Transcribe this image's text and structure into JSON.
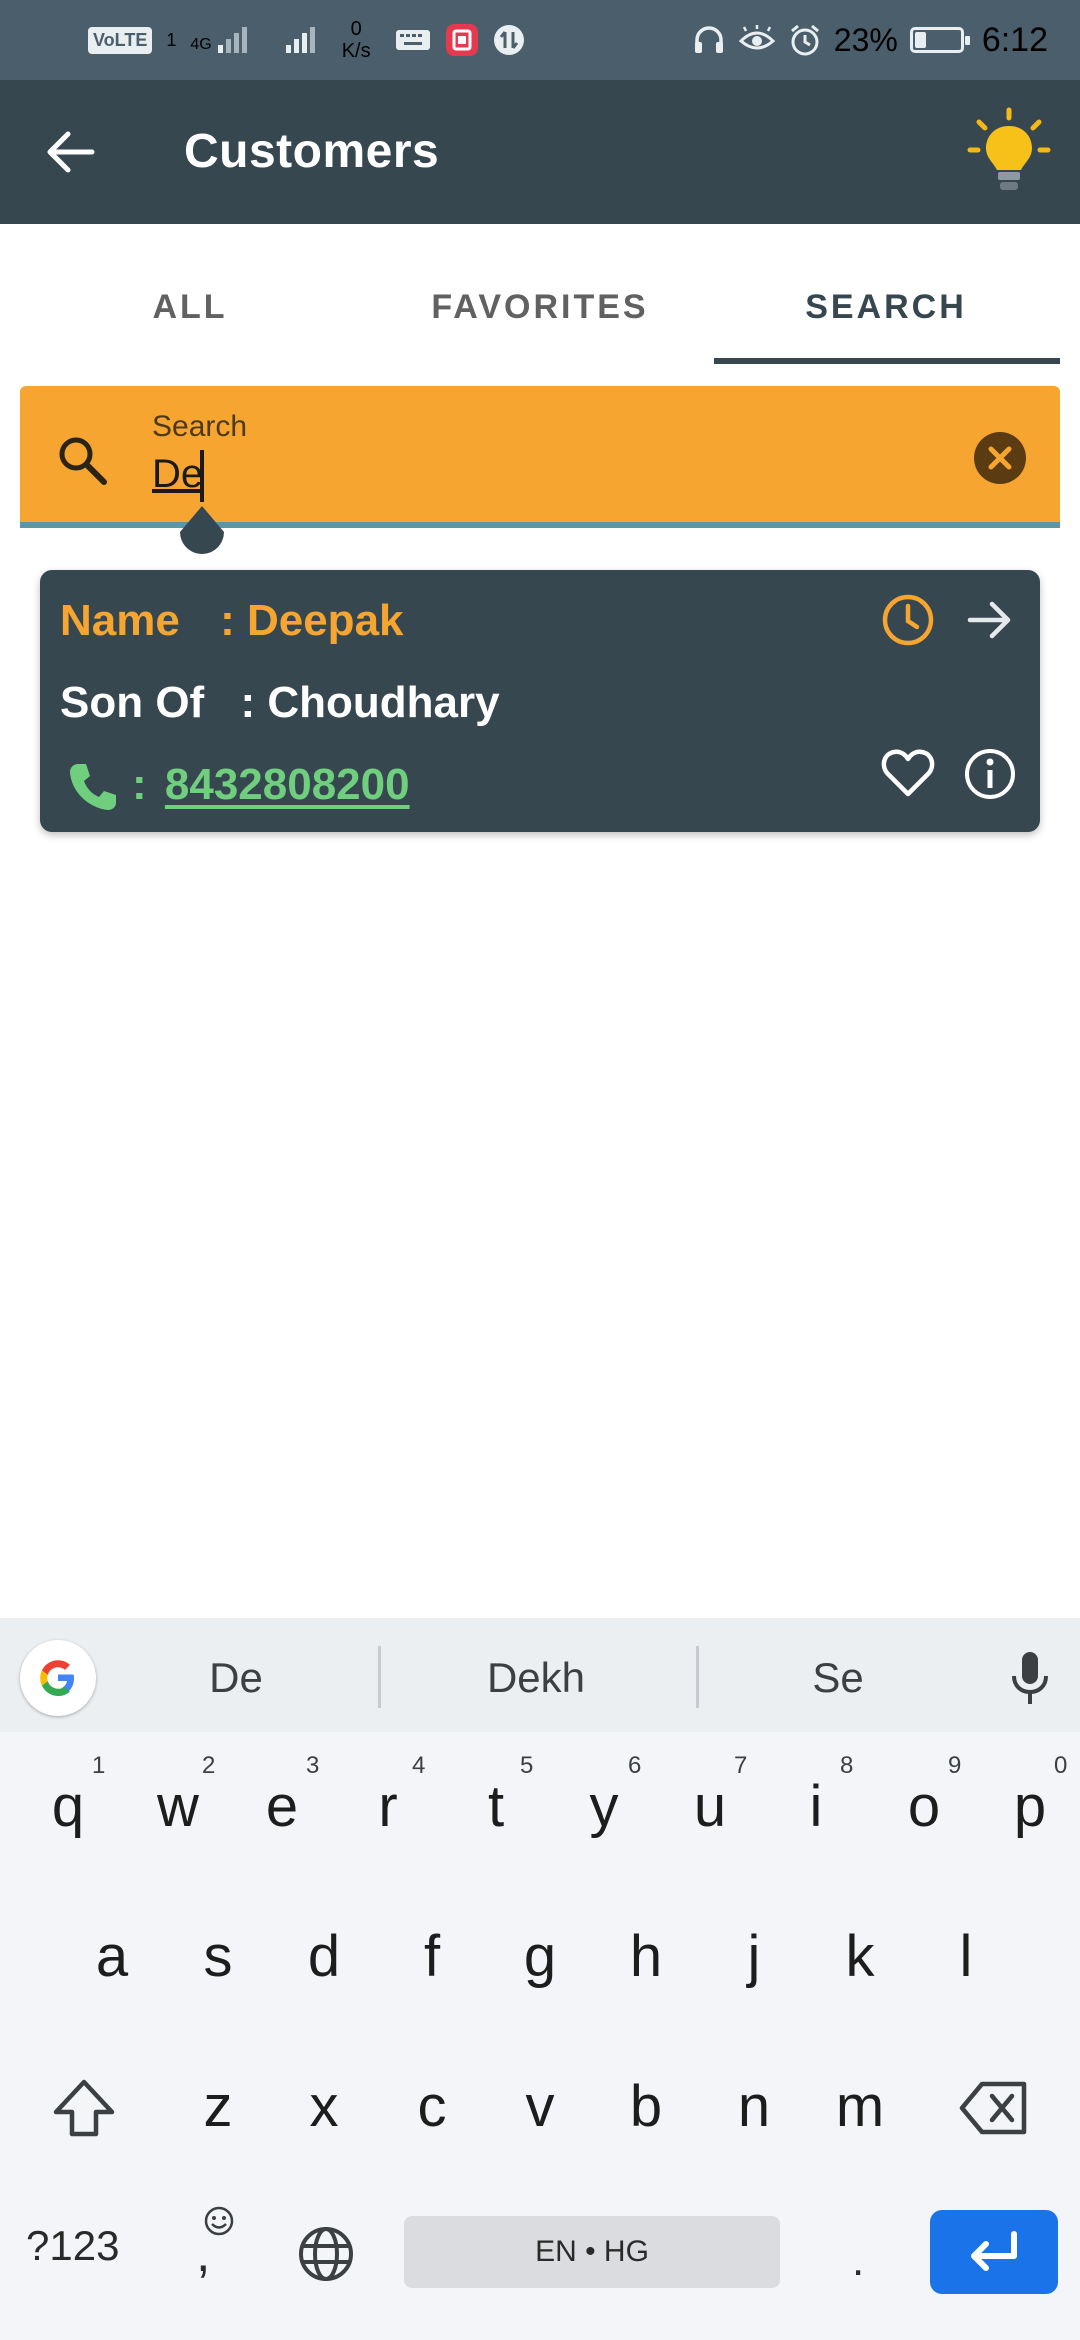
{
  "status_bar": {
    "volte": "VoLTE",
    "sim1": "1",
    "network_type": "4G",
    "speed_value": "0",
    "speed_unit": "K/s",
    "battery_percent": "23%",
    "battery_level": 0.23,
    "time": "6:12",
    "icons": [
      "volte-icon",
      "signal-icon",
      "signal2-icon",
      "keyboard-icon",
      "screen-record-icon",
      "data-icon",
      "headset-icon",
      "eye-icon",
      "alarm-icon",
      "battery-icon"
    ]
  },
  "appbar": {
    "title": "Customers",
    "back_icon": "arrow-left-icon",
    "action_icon": "lightbulb-icon"
  },
  "tabs": [
    {
      "label": "ALL",
      "active": false
    },
    {
      "label": "FAVORITES",
      "active": false
    },
    {
      "label": "SEARCH",
      "active": true
    }
  ],
  "search": {
    "label": "Search",
    "value": "De",
    "search_icon": "search-icon",
    "clear_icon": "clear-icon"
  },
  "results": [
    {
      "name_label": "Name",
      "name_sep": ":",
      "name": "Deepak",
      "son_of_label": "Son Of",
      "son_of_sep": ":",
      "son_of": "Choudhary",
      "phone_sep": ":",
      "phone": "8432808200",
      "icons": [
        "clock-icon",
        "arrow-right-icon",
        "phone-icon",
        "heart-icon",
        "info-icon"
      ]
    }
  ],
  "keyboard": {
    "suggestions": [
      "De",
      "Dekh",
      "Se"
    ],
    "row1": [
      "q",
      "w",
      "e",
      "r",
      "t",
      "y",
      "u",
      "i",
      "o",
      "p"
    ],
    "row1_hints": [
      "1",
      "2",
      "3",
      "4",
      "5",
      "6",
      "7",
      "8",
      "9",
      "0"
    ],
    "row2": [
      "a",
      "s",
      "d",
      "f",
      "g",
      "h",
      "j",
      "k",
      "l"
    ],
    "row3": [
      "z",
      "x",
      "c",
      "v",
      "b",
      "n",
      "m"
    ],
    "sym_label": "?123",
    "comma": ",",
    "period": ".",
    "space_label": "EN • HG",
    "colors": {
      "enter": "#1a73e8",
      "accent": "#f6a630",
      "bar": "#37474f"
    }
  }
}
